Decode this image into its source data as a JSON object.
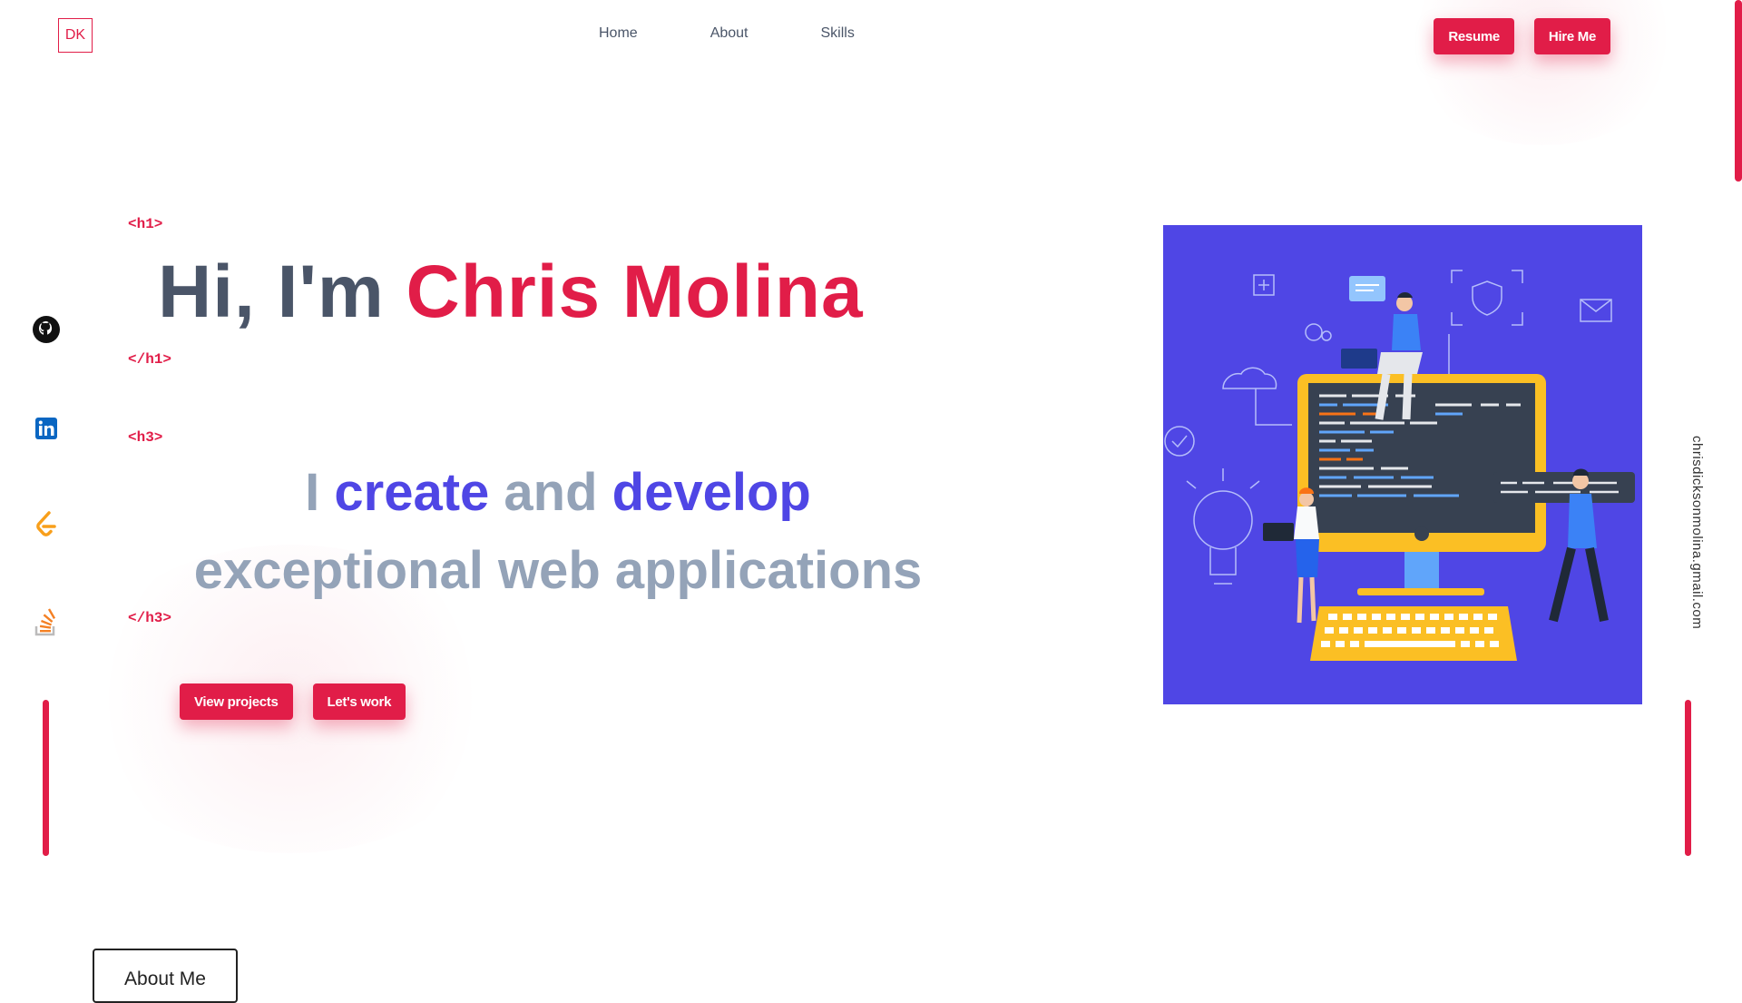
{
  "header": {
    "logo": "DK",
    "nav": [
      "Home",
      "About",
      "Skills"
    ],
    "buttons": {
      "resume": "Resume",
      "hire": "Hire Me"
    }
  },
  "hero": {
    "tags": {
      "h1_open": "<h1>",
      "h1_close": "</h1>",
      "h3_open": "<h3>",
      "h3_close": "</h3>"
    },
    "greeting": "Hi, I'm ",
    "name": "Chris Molina",
    "tagline": {
      "w1": "I ",
      "w2": "create",
      "w3": " and ",
      "w4": "develop",
      "w5": " exceptional web applications"
    },
    "buttons": {
      "projects": "View projects",
      "work": "Let's work"
    }
  },
  "social": [
    "github-icon",
    "linkedin-icon",
    "leetcode-icon",
    "stackoverflow-icon"
  ],
  "email": "chrisdicksonmolina.gmail.com",
  "about": {
    "label": "About Me"
  },
  "colors": {
    "accent": "#e11d48",
    "brand_blue": "#4f46e5",
    "muted": "#94a3b8",
    "text": "#4a5568"
  }
}
